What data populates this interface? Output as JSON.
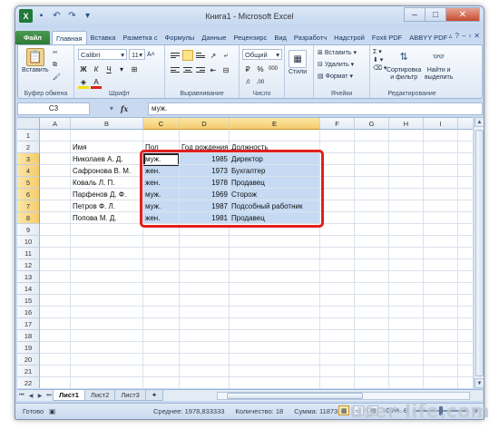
{
  "window": {
    "title": "Книга1 - Microsoft Excel",
    "logo": "X"
  },
  "ribbon_tabs": [
    "Файл",
    "Главная",
    "Вставка",
    "Разметка с",
    "Формулы",
    "Данные",
    "Рецензирс",
    "Вид",
    "Разработч",
    "Надстрой",
    "Foxit PDF",
    "ABBYY PDF"
  ],
  "ribbon": {
    "clipboard": {
      "paste": "Вставить",
      "label": "Буфер обмена"
    },
    "font": {
      "name": "Calibri",
      "size": "11",
      "bold": "Ж",
      "italic": "К",
      "underline": "Ч",
      "label": "Шрифт"
    },
    "alignment": {
      "label": "Выравнивание"
    },
    "number": {
      "format": "Общий",
      "percent": "%",
      "thousands": "000",
      "label": "Число"
    },
    "styles": {
      "label": "Стили"
    },
    "cells": {
      "insert": "Вставить",
      "delete": "Удалить",
      "format": "Формат",
      "label": "Ячейки"
    },
    "editing": {
      "sort": "Сортировка\nи фильтр",
      "find": "Найти и\nвыделить",
      "label": "Редактирование"
    }
  },
  "formula_bar": {
    "name_box": "C3",
    "fx": "fx",
    "content": "муж."
  },
  "columns": [
    "A",
    "B",
    "C",
    "D",
    "E",
    "F",
    "G",
    "H",
    "I"
  ],
  "rows": [
    "1",
    "2",
    "3",
    "4",
    "5",
    "6",
    "7",
    "8",
    "9",
    "10",
    "11",
    "12",
    "13",
    "14",
    "15",
    "16",
    "17",
    "18",
    "19",
    "20",
    "21",
    "22"
  ],
  "table": {
    "headers": {
      "name": "Имя",
      "gender": "Пол",
      "year": "Год рождения",
      "position": "Должность"
    },
    "records": [
      {
        "name": "Николаев А. Д.",
        "gender": "муж.",
        "year": "1985",
        "position": "Директор"
      },
      {
        "name": "Сафронова В. М.",
        "gender": "жен.",
        "year": "1973",
        "position": "Бухгалтер"
      },
      {
        "name": "Коваль Л. П.",
        "gender": "жен.",
        "year": "1978",
        "position": "Продавец"
      },
      {
        "name": "Парфенов Д. Ф.",
        "gender": "муж.",
        "year": "1969",
        "position": "Сторож"
      },
      {
        "name": "Петров Ф. Л.",
        "gender": "муж.",
        "year": "1987",
        "position": "Подсобный работник"
      },
      {
        "name": "Попова М. Д.",
        "gender": "жен.",
        "year": "1981",
        "position": "Продавец"
      }
    ]
  },
  "sheet_tabs": [
    "Лист1",
    "Лист2",
    "Лист3"
  ],
  "status_bar": {
    "ready": "Готово",
    "average": "Среднее: 1978,833333",
    "count": "Количество: 18",
    "sum": "Сумма: 11873",
    "zoom": "100%"
  },
  "watermark": "user-life.com",
  "colors": {
    "selection": "#c6dbf3",
    "highlight_border": "#e0201c",
    "file_tab": "#2d7a36"
  }
}
